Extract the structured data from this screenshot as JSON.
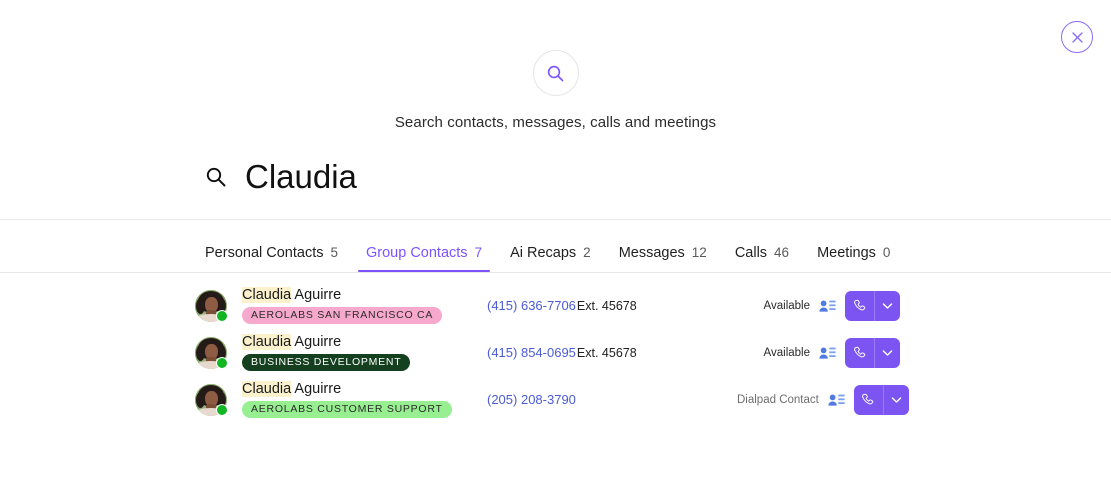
{
  "window": {
    "close_label": "×",
    "close_icon": "close-circle-icon",
    "accent_color": "#7c52ff",
    "button_color": "#7b54f2"
  },
  "hero": {
    "search_icon": "search-icon",
    "subtitle": "Search contacts, messages, calls and meetings"
  },
  "query": {
    "icon": "search-icon",
    "text": "Claudia"
  },
  "tabs": [
    {
      "label": "Personal Contacts",
      "count": "5",
      "active": false
    },
    {
      "label": "Group Contacts",
      "count": "7",
      "active": true
    },
    {
      "label": "Ai Recaps",
      "count": "2",
      "active": false
    },
    {
      "label": "Messages",
      "count": "12",
      "active": false
    },
    {
      "label": "Calls",
      "count": "46",
      "active": false
    },
    {
      "label": "Meetings",
      "count": "0",
      "active": false
    }
  ],
  "results": [
    {
      "name_highlight": "Claudia",
      "name_rest": " Aguirre",
      "tag": "AEROLABS SAN FRANCISCO CA",
      "tag_bg": "#f7a8cd",
      "tag_fg": "#2b2b2b",
      "phone": "(415) 636-7706",
      "ext": "Ext. 45678",
      "presence": "Available",
      "presence_muted": false,
      "status_dot_color": "#12b622",
      "card_icon": "contact-card-icon",
      "call_icon": "phone-icon",
      "caret_icon": "chevron-down-icon"
    },
    {
      "name_highlight": "Claudia",
      "name_rest": " Aguirre",
      "tag": "BUSINESS DEVELOPMENT",
      "tag_bg": "#15401f",
      "tag_fg": "#ffffff",
      "phone": "(415) 854-0695",
      "ext": "Ext. 45678",
      "presence": "Available",
      "presence_muted": false,
      "status_dot_color": "#12b622",
      "card_icon": "contact-card-icon",
      "call_icon": "phone-icon",
      "caret_icon": "chevron-down-icon"
    },
    {
      "name_highlight": "Claudia",
      "name_rest": " Aguirre",
      "tag": "AEROLABS CUSTOMER SUPPORT",
      "tag_bg": "#97ef92",
      "tag_fg": "#2b2b2b",
      "phone": "(205) 208-3790",
      "ext": "",
      "presence": "Dialpad Contact",
      "presence_muted": true,
      "status_dot_color": "#12b622",
      "card_icon": "contact-card-icon",
      "call_icon": "phone-icon",
      "caret_icon": "chevron-down-icon"
    }
  ]
}
